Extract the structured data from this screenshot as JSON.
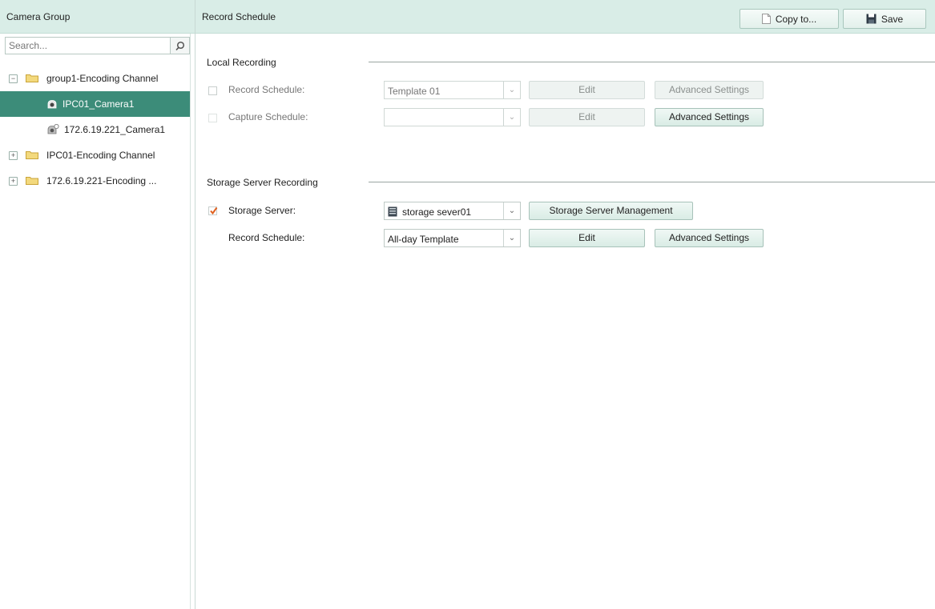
{
  "left_panel": {
    "title": "Camera Group",
    "search": {
      "placeholder": "Search...",
      "value": ""
    },
    "tree": [
      {
        "label": "group1-Encoding Channel",
        "expander": "−"
      },
      {
        "label": "IPC01_Camera1"
      },
      {
        "label": "172.6.19.221_Camera1"
      },
      {
        "label": "IPC01-Encoding Channel",
        "expander": "+"
      },
      {
        "label": "172.6.19.221-Encoding ...",
        "expander": "+"
      }
    ]
  },
  "right_panel": {
    "title": "Record Schedule",
    "copy_label": "Copy to...",
    "save_label": "Save",
    "local": {
      "title": "Local Recording",
      "record_schedule": {
        "label": "Record Schedule:",
        "value": "Template 01",
        "checked": false,
        "edit_label": "Edit",
        "advanced_label": "Advanced Settings"
      },
      "capture_schedule": {
        "label": "Capture Schedule:",
        "value": "",
        "checked": false,
        "edit_label": "Edit",
        "advanced_label": "Advanced Settings"
      }
    },
    "storage": {
      "title": "Storage Server Recording",
      "server": {
        "label": "Storage Server:",
        "value": "storage sever01",
        "checked": true,
        "manage_label": "Storage Server Management"
      },
      "record_schedule": {
        "label": "Record Schedule:",
        "value": "All-day Template",
        "edit_label": "Edit",
        "advanced_label": "Advanced Settings"
      }
    }
  },
  "icons": {
    "search": "search-icon",
    "folder": "folder-icon",
    "camera": "camera-icon",
    "copy": "copy-icon",
    "save": "save-icon",
    "server": "server-icon",
    "dropdown": "chevron-down-icon"
  },
  "colors": {
    "header_bg": "#d9ede7",
    "selected_bg": "#3c8c79",
    "checkbox_check": "#e0601f"
  }
}
